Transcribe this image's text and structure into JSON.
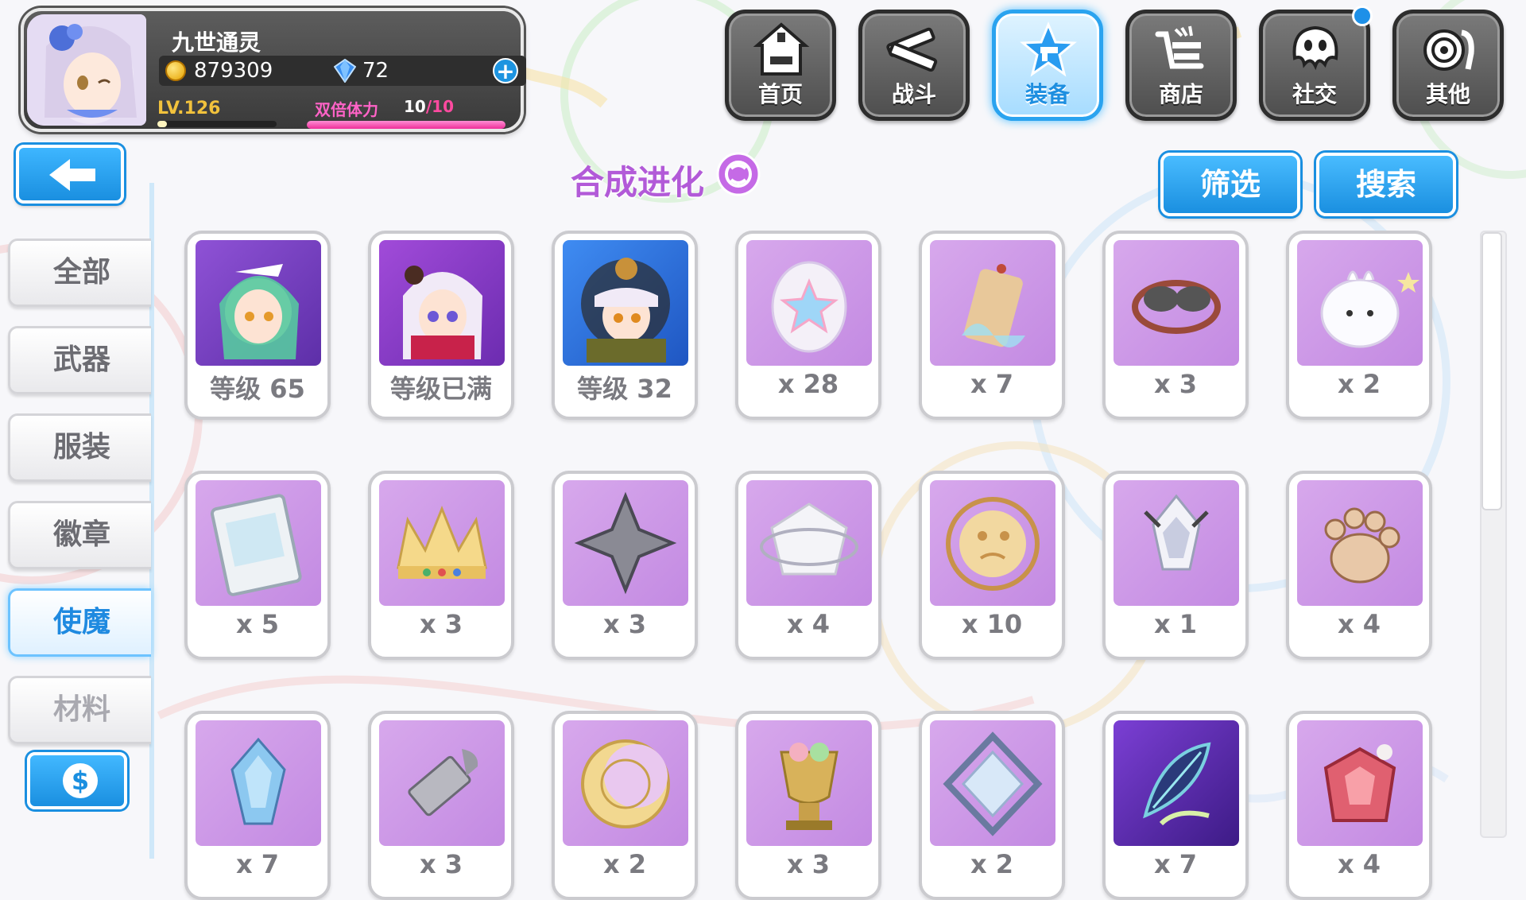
{
  "player": {
    "name": "九世通灵",
    "gold": "879309",
    "gems": "72",
    "level": "LV.126",
    "level_progress": 0.08,
    "stamina_label": "双倍体力",
    "stamina_current": "10",
    "stamina_max": "/10",
    "stamina_progress": 1.0
  },
  "nav": {
    "items": [
      {
        "label": "首页",
        "icon": "house-icon"
      },
      {
        "label": "战斗",
        "icon": "crossed-guns-icon"
      },
      {
        "label": "装备",
        "icon": "star-gun-icon"
      },
      {
        "label": "商店",
        "icon": "cart-icon"
      },
      {
        "label": "社交",
        "icon": "ghost-face-icon"
      },
      {
        "label": "其他",
        "icon": "snail-icon"
      }
    ],
    "active": "装备"
  },
  "sidebar": {
    "back_icon": "back-arrow-icon",
    "tabs": [
      {
        "label": "全部"
      },
      {
        "label": "武器"
      },
      {
        "label": "服装"
      },
      {
        "label": "徽章"
      },
      {
        "label": "使魔"
      },
      {
        "label": "材料"
      }
    ],
    "active": "使魔",
    "shop_icon": "dollar-icon"
  },
  "section": {
    "title": "合成进化",
    "filter_label": "筛选",
    "search_label": "搜索"
  },
  "items": [
    {
      "count": "等级 65",
      "icon": "green-hair-girl-portrait"
    },
    {
      "count": "等级已满",
      "icon": "white-hair-girl-portrait"
    },
    {
      "count": "等级 32",
      "icon": "goggles-girl-portrait"
    },
    {
      "count": "x 28",
      "icon": "star-egg-icon"
    },
    {
      "count": "x 7",
      "icon": "charm-tag-icon"
    },
    {
      "count": "x 3",
      "icon": "goggles-icon"
    },
    {
      "count": "x 2",
      "icon": "white-blob-icon"
    },
    {
      "count": "x 5",
      "icon": "game-cartridge-icon"
    },
    {
      "count": "x 3",
      "icon": "crown-icon"
    },
    {
      "count": "x 3",
      "icon": "iron-cross-icon"
    },
    {
      "count": "x 4",
      "icon": "white-cube-icon"
    },
    {
      "count": "x 10",
      "icon": "cookie-ring-icon"
    },
    {
      "count": "x 1",
      "icon": "crystal-flower-icon"
    },
    {
      "count": "x 4",
      "icon": "paw-icon"
    },
    {
      "count": "x 7",
      "icon": "blue-crystal-icon"
    },
    {
      "count": "x 3",
      "icon": "bullet-icon"
    },
    {
      "count": "x 2",
      "icon": "moon-emblem-icon"
    },
    {
      "count": "x 3",
      "icon": "trophy-cup-icon"
    },
    {
      "count": "x 2",
      "icon": "crystal-frame-icon"
    },
    {
      "count": "x 7",
      "icon": "dark-feather-icon"
    },
    {
      "count": "x 4",
      "icon": "red-gem-box-icon"
    }
  ]
}
